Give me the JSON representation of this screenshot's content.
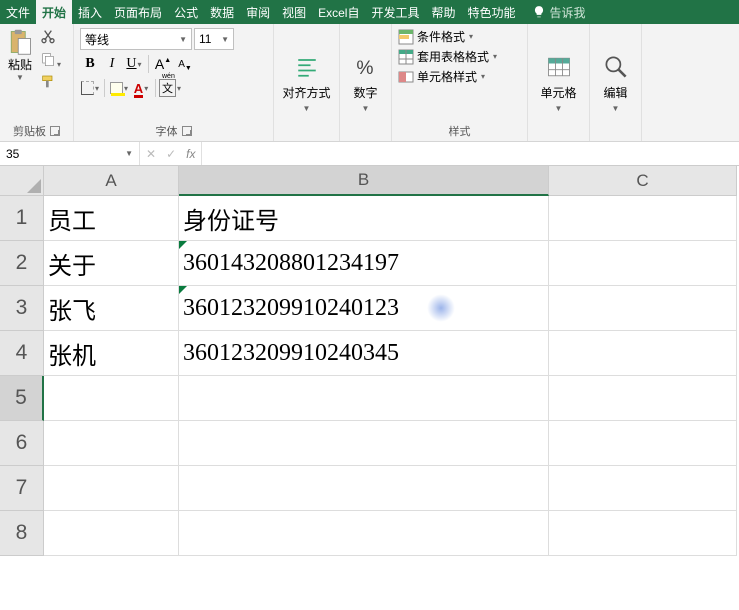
{
  "tabs": {
    "file": "文件",
    "home": "开始",
    "insert": "插入",
    "layout": "页面布局",
    "formulas": "公式",
    "data": "数据",
    "review": "审阅",
    "view": "视图",
    "excelauto": "Excel自",
    "dev": "开发工具",
    "help": "帮助",
    "special": "特色功能",
    "tellme": "告诉我"
  },
  "ribbon": {
    "clipboard": {
      "paste": "粘贴",
      "label": "剪贴板"
    },
    "font": {
      "name": "等线",
      "size": "11",
      "B": "B",
      "I": "I",
      "U": "U",
      "wen": "文",
      "wenRuby": "wén",
      "A": "A",
      "label": "字体"
    },
    "align": {
      "btn": "对齐方式"
    },
    "number": {
      "btn": "数字"
    },
    "styles": {
      "cond": "条件格式",
      "tablefmt": "套用表格格式",
      "cellstyle": "单元格样式",
      "label": "样式"
    },
    "cells": {
      "btn": "单元格"
    },
    "editing": {
      "btn": "编辑"
    }
  },
  "fbar": {
    "name": "35",
    "fx": "fx"
  },
  "grid": {
    "cols": {
      "A": "A",
      "B": "B",
      "C": "C"
    },
    "rows": [
      "1",
      "2",
      "3",
      "4",
      "5",
      "6",
      "7",
      "8"
    ],
    "data": {
      "A1": "员工",
      "B1": "身份证号",
      "A2": "关于",
      "B2": "360143208801234197",
      "A3": "张飞",
      "B3": "360123209910240123",
      "A4": "张机",
      "B4": "360123209910240345"
    }
  }
}
